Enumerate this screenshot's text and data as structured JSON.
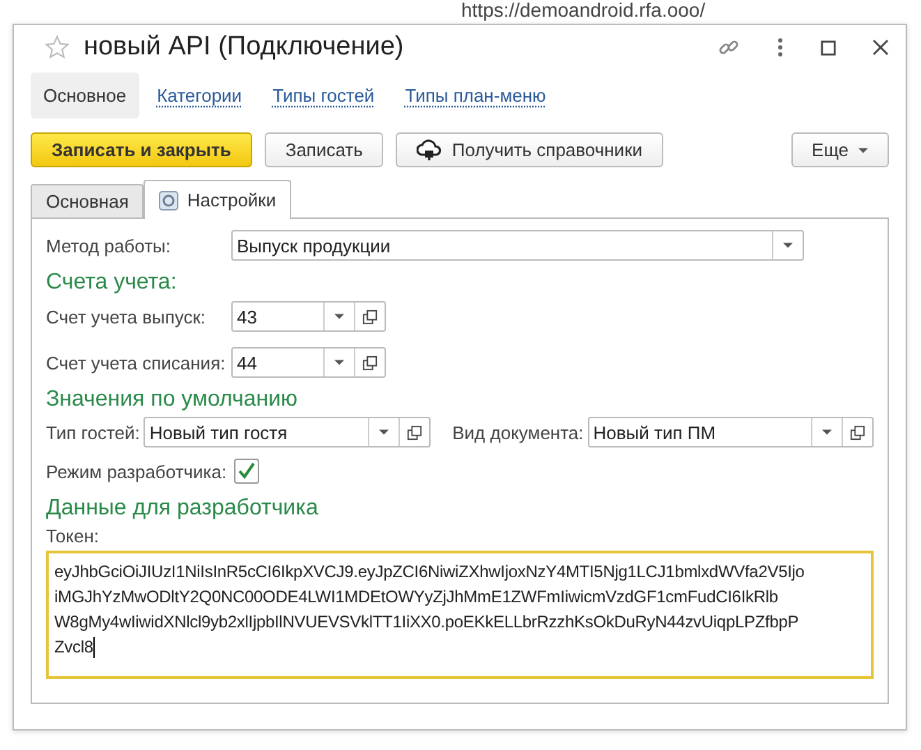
{
  "background_url": "https://demoandroid.rfa.ooo/",
  "window": {
    "title": "новый API (Подключение)"
  },
  "nav": [
    {
      "label": "Основное",
      "selected": true
    },
    {
      "label": "Категории",
      "selected": false
    },
    {
      "label": "Типы гостей",
      "selected": false
    },
    {
      "label": "Типы план-меню",
      "selected": false
    }
  ],
  "buttons": [
    {
      "label": "Записать и закрыть",
      "kind": "primary"
    },
    {
      "label": "Записать",
      "kind": "plain"
    },
    {
      "label": "Получить справочники",
      "kind": "icon"
    }
  ],
  "more_button": "Еще",
  "tabs": [
    {
      "label": "Основная",
      "selected": false
    },
    {
      "label": "Настройки",
      "selected": true
    }
  ],
  "method": {
    "label": "Метод работы:",
    "value": "Выпуск продукции"
  },
  "accounts": {
    "heading": "Счета учета:",
    "fields": [
      {
        "label": "Счет учета выпуск:",
        "value": "43"
      },
      {
        "label": "Счет учета списания:",
        "value": "44"
      }
    ]
  },
  "defaults": {
    "heading": "Значения по умолчанию",
    "fields": [
      {
        "label": "Тип гостей:",
        "value": "Новый тип гостя"
      },
      {
        "label": "Вид документа:",
        "value": "Новый тип ПМ"
      }
    ]
  },
  "developer_mode": {
    "label": "Режим разработчика:",
    "checked": true
  },
  "developer": {
    "heading": "Данные для разработчика",
    "token_label": "Токен:",
    "token_lines": [
      "eyJhbGciOiJIUzI1NiIsInR5cCI6IkpXVCJ9.eyJpZCI6NiwiZXhwIjoxNzY4MTI5Njg1LCJ1bmlxdWVfa2V5Ijo",
      "iMGJhYzMwODltY2Q0NC00ODE4LWI1MDEtOWYyZjJhMmE1ZWFmIiwicmVzdGF1cmFudCI6IkRlb",
      "W8gMy4wIiwidXNlcl9yb2xlIjpbIlNVUEVSVklTT1IiXX0.poEKkELLbrRzzhKsOkDuRyN44zvUiqpLPZfbpP",
      "Zvcl8"
    ]
  }
}
